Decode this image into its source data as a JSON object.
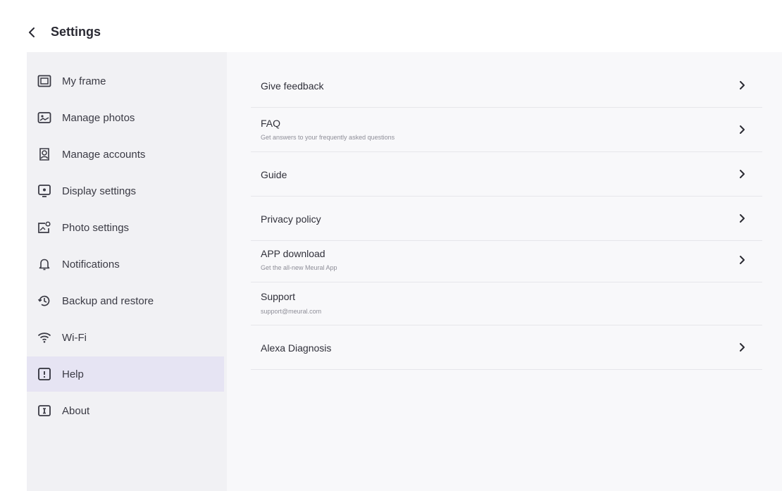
{
  "header": {
    "title": "Settings",
    "back_icon": "chevron-left-icon"
  },
  "sidebar": {
    "items": [
      {
        "label": "My frame",
        "icon": "frame-icon"
      },
      {
        "label": "Manage photos",
        "icon": "photos-icon"
      },
      {
        "label": "Manage accounts",
        "icon": "accounts-icon"
      },
      {
        "label": "Display settings",
        "icon": "display-icon"
      },
      {
        "label": "Photo settings",
        "icon": "photo-settings-icon"
      },
      {
        "label": "Notifications",
        "icon": "bell-icon"
      },
      {
        "label": "Backup and restore",
        "icon": "backup-icon"
      },
      {
        "label": "Wi-Fi",
        "icon": "wifi-icon"
      },
      {
        "label": "Help",
        "icon": "help-icon",
        "active": true
      },
      {
        "label": "About",
        "icon": "info-icon"
      }
    ]
  },
  "help": {
    "items": [
      {
        "title": "Give feedback",
        "subtitle": "",
        "chevron": true
      },
      {
        "title": "FAQ",
        "subtitle": "Get answers to your frequently asked questions",
        "chevron": true
      },
      {
        "title": "Guide",
        "subtitle": "",
        "chevron": true
      },
      {
        "title": "Privacy policy",
        "subtitle": "",
        "chevron": true
      },
      {
        "title": "APP download",
        "subtitle": "Get the all-new Meural App",
        "chevron": true
      },
      {
        "title": "Support",
        "subtitle": "support@meural.com",
        "chevron": false
      },
      {
        "title": "Alexa Diagnosis",
        "subtitle": "",
        "chevron": true
      }
    ]
  },
  "colors": {
    "active_bg": "#e6e4f3",
    "sidebar_bg": "#f1f1f4",
    "content_bg": "#f8f8fa",
    "text": "#2b2b33"
  }
}
